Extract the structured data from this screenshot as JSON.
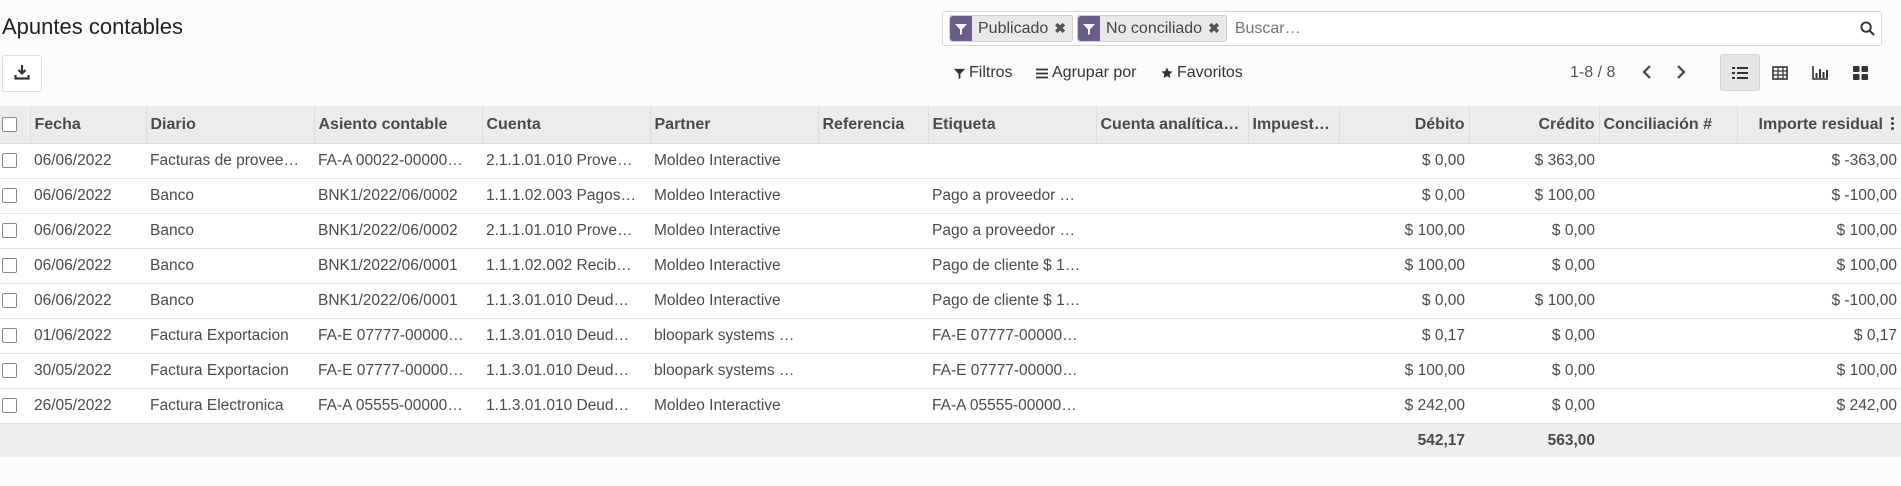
{
  "page": {
    "title": "Apuntes contables"
  },
  "search": {
    "facets": [
      {
        "label": "Publicado",
        "icon": "filter-icon"
      },
      {
        "label": "No conciliado",
        "icon": "filter-icon"
      }
    ],
    "placeholder": "Buscar…"
  },
  "controls": {
    "filters_label": "Filtros",
    "group_by_label": "Agrupar por",
    "favorites_label": "Favoritos"
  },
  "pager": {
    "value": "1-8 / 8"
  },
  "colors": {
    "accent": "#6c5e8c",
    "header_bg": "#ececec",
    "footer_bg": "#eeeeee"
  },
  "table": {
    "headers": [
      "Fecha",
      "Diario",
      "Asiento contable",
      "Cuenta",
      "Partner",
      "Referencia",
      "Etiqueta",
      "Cuenta analítica…",
      "Impuest…",
      "Débito",
      "Crédito",
      "Conciliación #",
      "Importe residual"
    ],
    "rows": [
      [
        "06/06/2022",
        "Facturas de provee…",
        "FA-A 00022-00000…",
        "2.1.1.01.010 Prove…",
        "Moldeo Interactive",
        "",
        "",
        "",
        "",
        "$ 0,00",
        "$ 363,00",
        "",
        "$ -363,00"
      ],
      [
        "06/06/2022",
        "Banco",
        "BNK1/2022/06/0002",
        "1.1.1.02.003 Pagos…",
        "Moldeo Interactive",
        "",
        "Pago a proveedor …",
        "",
        "",
        "$ 0,00",
        "$ 100,00",
        "",
        "$ -100,00"
      ],
      [
        "06/06/2022",
        "Banco",
        "BNK1/2022/06/0002",
        "2.1.1.01.010 Prove…",
        "Moldeo Interactive",
        "",
        "Pago a proveedor …",
        "",
        "",
        "$ 100,00",
        "$ 0,00",
        "",
        "$ 100,00"
      ],
      [
        "06/06/2022",
        "Banco",
        "BNK1/2022/06/0001",
        "1.1.1.02.002 Recib…",
        "Moldeo Interactive",
        "",
        "Pago de cliente $ 1…",
        "",
        "",
        "$ 100,00",
        "$ 0,00",
        "",
        "$ 100,00"
      ],
      [
        "06/06/2022",
        "Banco",
        "BNK1/2022/06/0001",
        "1.1.3.01.010 Deud…",
        "Moldeo Interactive",
        "",
        "Pago de cliente $ 1…",
        "",
        "",
        "$ 0,00",
        "$ 100,00",
        "",
        "$ -100,00"
      ],
      [
        "01/06/2022",
        "Factura Exportacion",
        "FA-E 07777-00000…",
        "1.1.3.01.010 Deud…",
        "bloopark systems …",
        "",
        "FA-E 07777-00000…",
        "",
        "",
        "$ 0,17",
        "$ 0,00",
        "",
        "$ 0,17"
      ],
      [
        "30/05/2022",
        "Factura Exportacion",
        "FA-E 07777-00000…",
        "1.1.3.01.010 Deud…",
        "bloopark systems …",
        "",
        "FA-E 07777-00000…",
        "",
        "",
        "$ 100,00",
        "$ 0,00",
        "",
        "$ 100,00"
      ],
      [
        "26/05/2022",
        "Factura Electronica",
        "FA-A 05555-00000…",
        "1.1.3.01.010 Deud…",
        "Moldeo Interactive",
        "",
        "FA-A 05555-00000…",
        "",
        "",
        "$ 242,00",
        "$ 0,00",
        "",
        "$ 242,00"
      ]
    ],
    "totals": {
      "debit": "542,17",
      "credit": "563,00"
    }
  }
}
